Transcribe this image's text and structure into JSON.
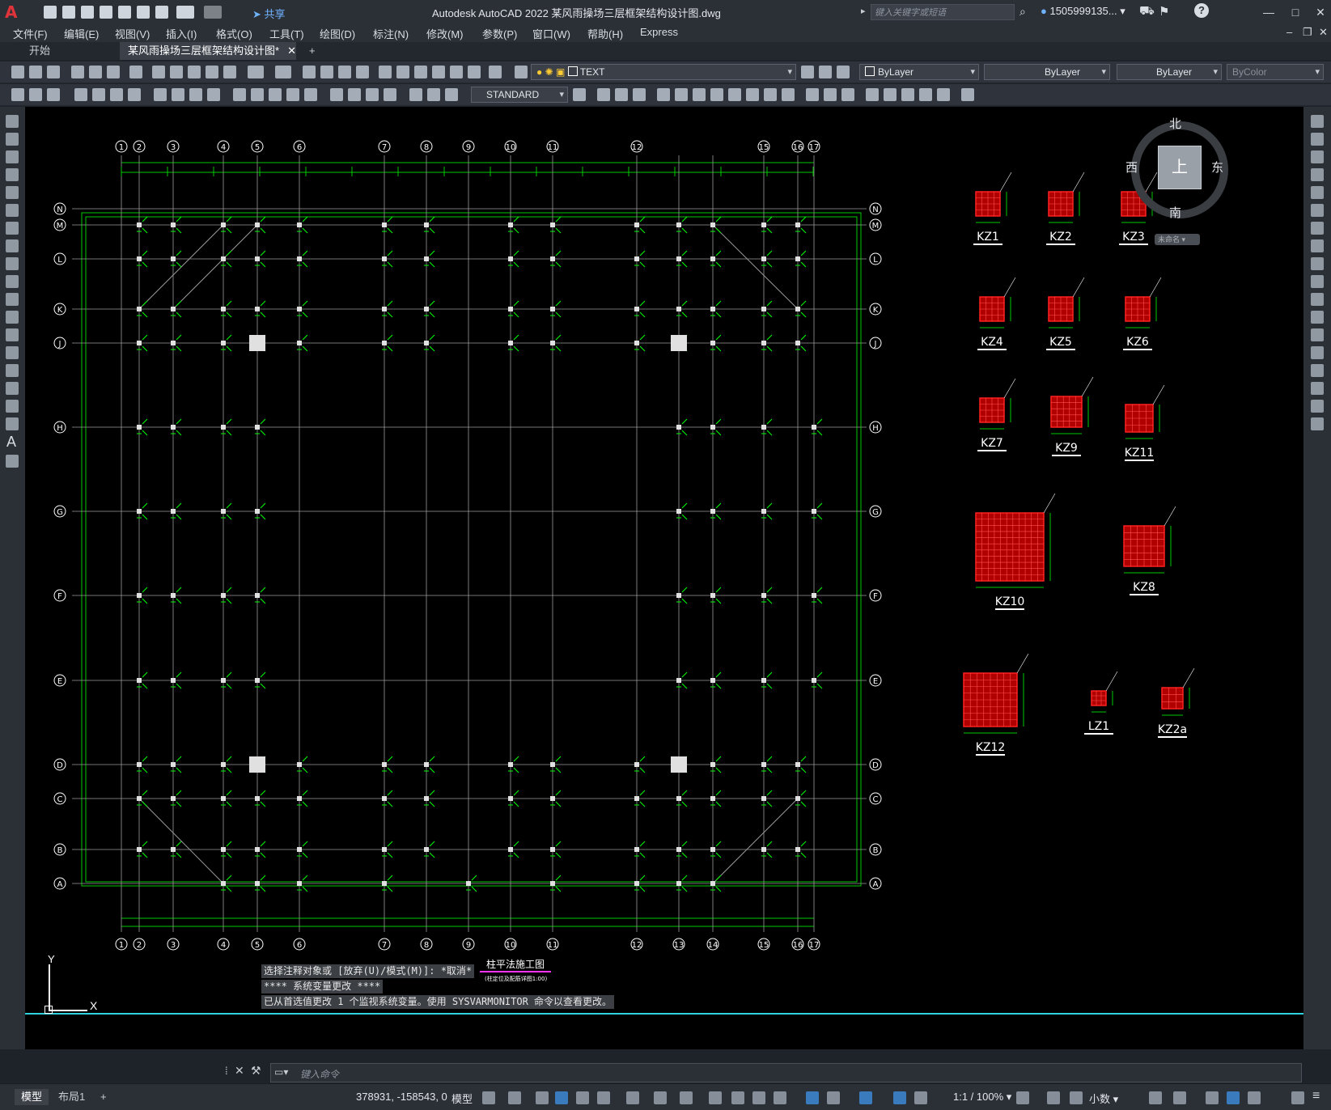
{
  "app": {
    "title": "Autodesk AutoCAD 2022    某风雨操场三层框架结构设计图.dwg",
    "share_label": "共享",
    "search_placeholder": "键入关键字或短语",
    "user": "1505999135...",
    "logo": "A"
  },
  "menu": [
    "文件(F)",
    "编辑(E)",
    "视图(V)",
    "插入(I)",
    "格式(O)",
    "工具(T)",
    "绘图(D)",
    "标注(N)",
    "修改(M)",
    "参数(P)",
    "窗口(W)",
    "帮助(H)",
    "Express"
  ],
  "tabs": [
    {
      "label": "开始",
      "active": false
    },
    {
      "label": "某风雨操场三层框架结构设计图*",
      "active": true
    }
  ],
  "toolbar": {
    "layer_value": "TEXT",
    "color_value": "ByLayer",
    "linetype_value": "ByLayer",
    "lineweight_value": "ByLayer",
    "plotstyle_value": "ByColor",
    "textstyle_value": "STANDARD"
  },
  "viewcube": {
    "north": "北",
    "south": "南",
    "east": "东",
    "west": "西",
    "top": "上",
    "wcs": "未命名"
  },
  "drawing": {
    "col_labels_top": [
      "1",
      "2",
      "3",
      "4",
      "5",
      "6",
      "7",
      "8",
      "9",
      "10",
      "11",
      "12",
      "15",
      "16",
      "17"
    ],
    "col_labels_bottom": [
      "1",
      "2",
      "3",
      "4",
      "5",
      "6",
      "7",
      "8",
      "9",
      "10",
      "11",
      "12",
      "13",
      "14",
      "15",
      "16",
      "17"
    ],
    "row_labels": [
      "N",
      "M",
      "L",
      "K",
      "J",
      "H",
      "G",
      "F",
      "E",
      "D",
      "C",
      "B",
      "A"
    ],
    "plan_title": "柱平法施工图",
    "plan_subtitle": "(柱定位及配筋详图1:00)",
    "details": [
      "KZ1",
      "KZ2",
      "KZ3",
      "KZ4",
      "KZ5",
      "KZ6",
      "KZ7",
      "KZ9",
      "KZ11",
      "KZ10",
      "KZ8",
      "KZ12",
      "LZ1",
      "KZ2a"
    ]
  },
  "command": {
    "history": [
      "选择注释对象或 [放弃(U)/模式(M)]: *取消*",
      "**** 系统变量更改 ****",
      "已从首选值更改 1 个监视系统变量。使用 SYSVARMONITOR 命令以查看更改。"
    ],
    "placeholder": "键入命令"
  },
  "ucs": {
    "y": "Y",
    "x": "X"
  },
  "status": {
    "layouts": [
      {
        "label": "模型",
        "active": true
      },
      {
        "label": "布局1",
        "active": false
      }
    ],
    "add": "+",
    "coords": "378931, -158543, 0",
    "model": "模型",
    "scale": "1:1 / 100%",
    "units": "小数"
  }
}
